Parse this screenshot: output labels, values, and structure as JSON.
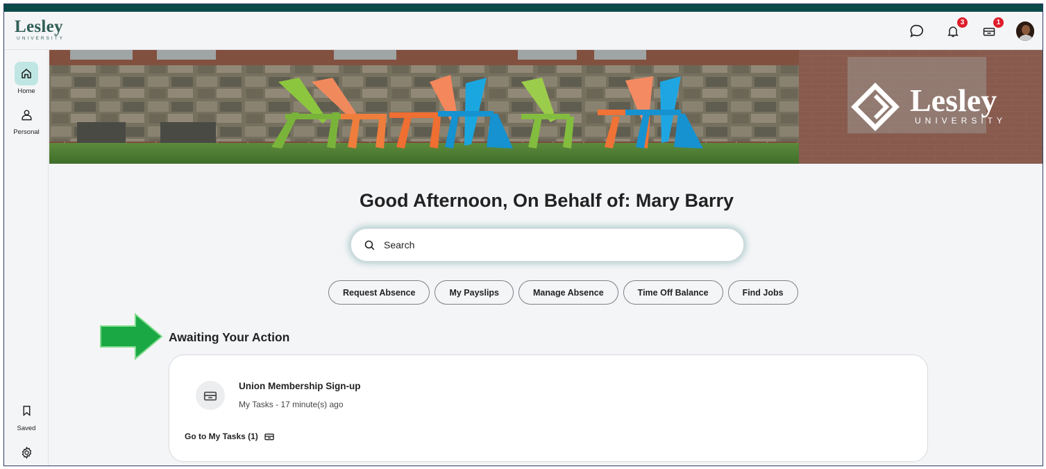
{
  "brand": {
    "logo_word": "Lesley",
    "logo_sub": "UNIVERSITY",
    "banner_word": "Lesley",
    "banner_sub": "UNIVERSITY"
  },
  "header": {
    "notifications_count": "3",
    "inbox_count": "1"
  },
  "sidebar": {
    "items": [
      {
        "label": "Home",
        "icon": "home-icon",
        "active": true
      },
      {
        "label": "Personal",
        "icon": "person-icon",
        "active": false
      },
      {
        "label": "Saved",
        "icon": "bookmark-icon",
        "active": false
      }
    ]
  },
  "main": {
    "greeting": "Good Afternoon, On Behalf of: Mary Barry",
    "search_placeholder": "Search",
    "quick_actions": [
      "Request Absence",
      "My Payslips",
      "Manage Absence",
      "Time Off Balance",
      "Find Jobs"
    ],
    "section_title": "Awaiting Your Action",
    "task": {
      "title": "Union Membership Sign-up",
      "meta": "My Tasks - 17 minute(s) ago",
      "link": "Go to My Tasks (1)"
    }
  },
  "colors": {
    "accent": "#0c4a4a",
    "active_nav_bg": "#bfe6e2",
    "badge": "#de1d2b",
    "arrow": "#1aa845",
    "brand_green": "#2f5e56"
  }
}
